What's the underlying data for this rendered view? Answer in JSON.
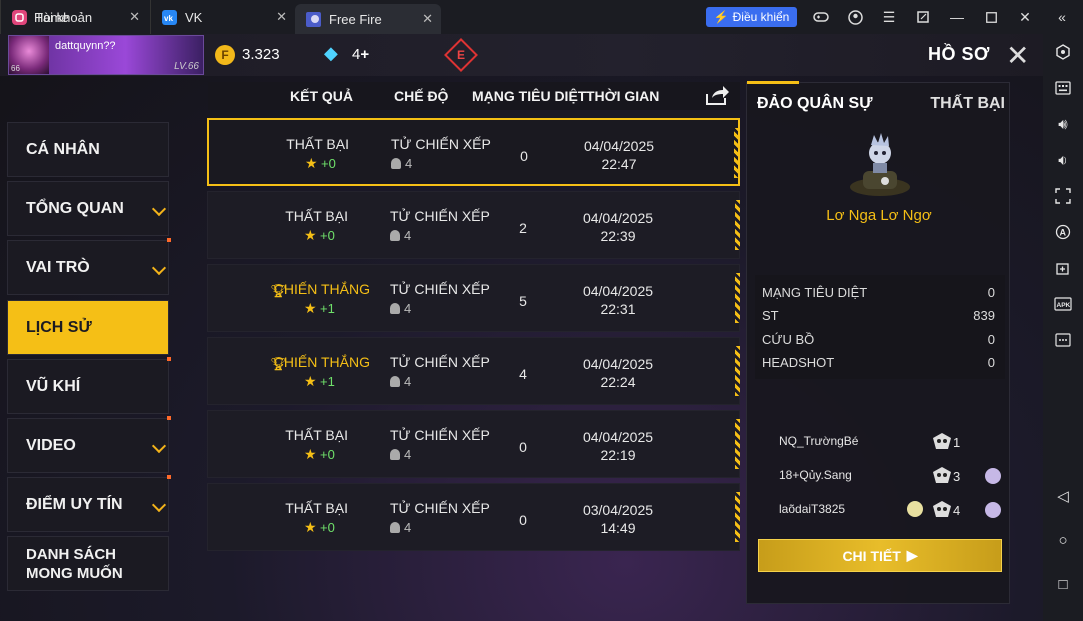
{
  "tabs": [
    {
      "label": "Home"
    },
    {
      "label": "Tài khoản"
    },
    {
      "label": "VK"
    },
    {
      "label": "Free Fire"
    }
  ],
  "toolbar": {
    "control_label": "Điều khiển"
  },
  "player": {
    "name": "dattquynn??",
    "level_badge": "66",
    "level": "LV.66"
  },
  "currency": {
    "gold": "3.323",
    "diamonds": "4"
  },
  "header": {
    "title": "HỒ SƠ"
  },
  "menu": [
    {
      "label": "CÁ NHÂN"
    },
    {
      "label": "TỔNG QUAN"
    },
    {
      "label": "VAI TRÒ"
    },
    {
      "label": "LỊCH SỬ"
    },
    {
      "label": "VŨ KHÍ"
    },
    {
      "label": "VIDEO"
    },
    {
      "label": "ĐIỂM UY TÍN"
    },
    {
      "label": "DANH SÁCH MONG MUỐN"
    }
  ],
  "table": {
    "headers": [
      "KẾT QUẢ",
      "CHẾ ĐỘ",
      "MẠNG TIÊU DIỆT",
      "THỜI GIAN"
    ],
    "rows": [
      {
        "result": "THẤT BẠI",
        "points": "+0",
        "mode": "TỬ CHIẾN XẾP HẠ",
        "players": "4",
        "kills": "0",
        "date": "04/04/2025",
        "time": "22:47"
      },
      {
        "result": "THẤT BẠI",
        "points": "+0",
        "mode": "TỬ CHIẾN XẾP HẠ",
        "players": "4",
        "kills": "2",
        "date": "04/04/2025",
        "time": "22:39"
      },
      {
        "result": "CHIẾN THẮNG",
        "points": "+1",
        "mode": "TỬ CHIẾN XẾP HẠ",
        "players": "4",
        "kills": "5",
        "date": "04/04/2025",
        "time": "22:31"
      },
      {
        "result": "CHIẾN THẮNG",
        "points": "+1",
        "mode": "TỬ CHIẾN XẾP HẠ",
        "players": "4",
        "kills": "4",
        "date": "04/04/2025",
        "time": "22:24"
      },
      {
        "result": "THẤT BẠI",
        "points": "+0",
        "mode": "TỬ CHIẾN XẾP HẠ",
        "players": "4",
        "kills": "0",
        "date": "04/04/2025",
        "time": "22:19"
      },
      {
        "result": "THẤT BẠI",
        "points": "+0",
        "mode": "TỬ CHIẾN XẾP HẠ",
        "players": "4",
        "kills": "0",
        "date": "03/04/2025",
        "time": "14:49"
      }
    ]
  },
  "detail": {
    "map": "ĐẢO QUÂN SỰ",
    "result": "THẤT BẠI",
    "character": "Lơ Nga Lơ Ngơ",
    "stats": [
      {
        "label": "MẠNG TIÊU DIỆT",
        "value": "0"
      },
      {
        "label": "ST",
        "value": "839"
      },
      {
        "label": "CỨU BỒ",
        "value": "0"
      },
      {
        "label": "HEADSHOT",
        "value": "0"
      }
    ],
    "team": [
      {
        "name": "NQ_TrườngBé",
        "kills": "1"
      },
      {
        "name": "18+Qủy.Sang",
        "kills": "3"
      },
      {
        "name": "laõdaiT3825",
        "kills": "4"
      }
    ],
    "button": "CHI TIẾT"
  }
}
